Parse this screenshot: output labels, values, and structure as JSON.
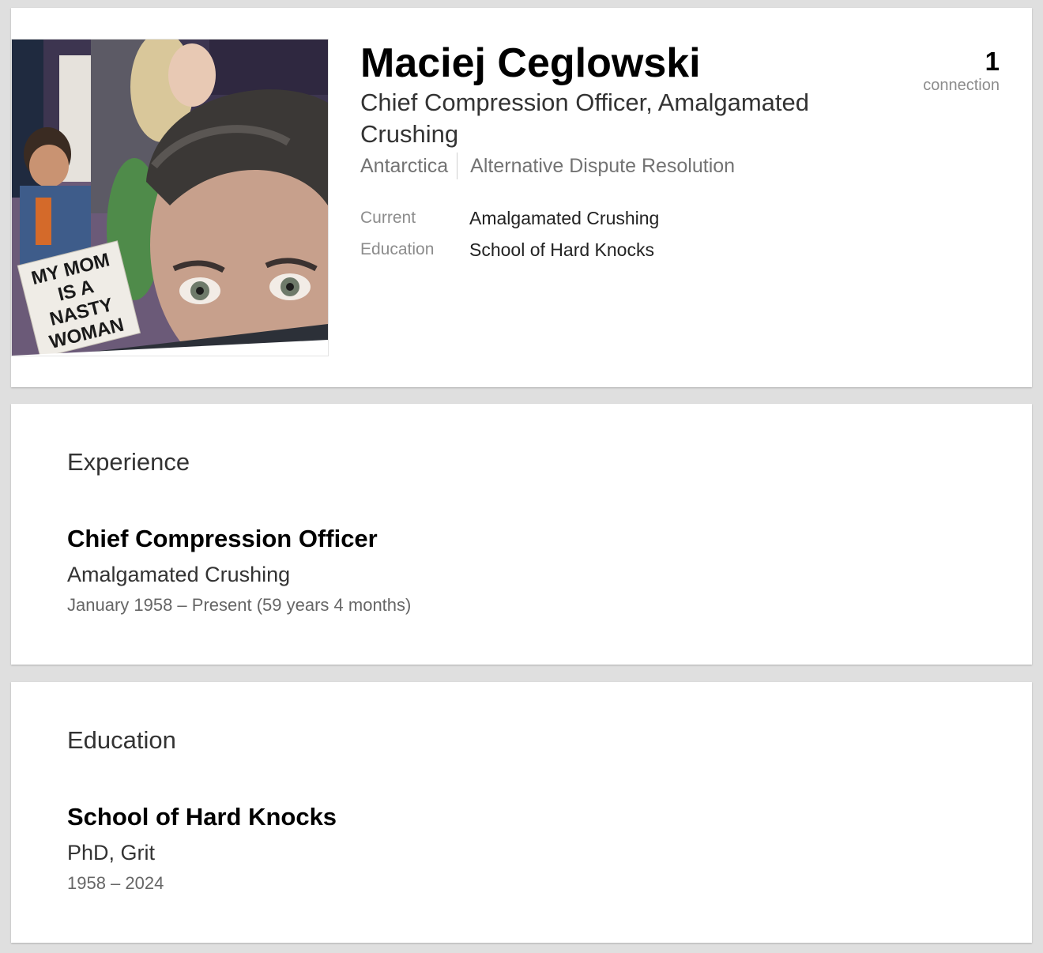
{
  "profile": {
    "name": "Maciej Ceglowski",
    "headline": "Chief Compression Officer, Amalgamated Crushing",
    "location": "Antarctica",
    "industry": "Alternative Dispute Resolution",
    "photo_sign_text": [
      "MY MOM",
      "IS A",
      "NASTY",
      "WOMAN"
    ],
    "facts": [
      {
        "label": "Current",
        "value": "Amalgamated Crushing"
      },
      {
        "label": "Education",
        "value": "School of Hard Knocks"
      }
    ],
    "connections": {
      "count": "1",
      "label": "connection"
    }
  },
  "experience": {
    "title": "Experience",
    "entries": [
      {
        "title": "Chief Compression Officer",
        "company": "Amalgamated Crushing",
        "dates": "January 1958 – Present (59 years 4 months)"
      }
    ]
  },
  "education": {
    "title": "Education",
    "entries": [
      {
        "school": "School of Hard Knocks",
        "degree": "PhD, Grit",
        "dates": "1958 – 2024"
      }
    ]
  }
}
